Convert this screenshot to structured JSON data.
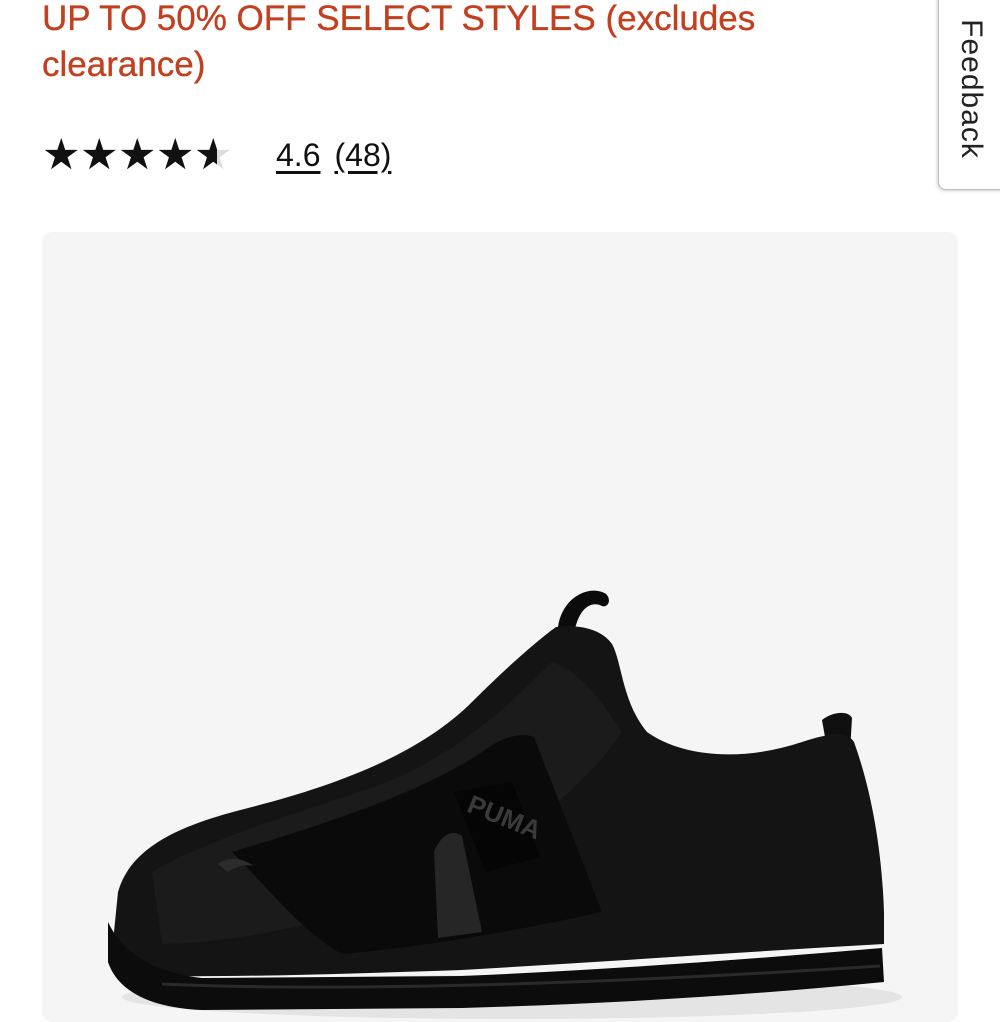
{
  "promo": {
    "text": "UP TO 50% OFF SELECT STYLES (excludes clearance)",
    "color": "#c2401f"
  },
  "rating": {
    "value": "4.6",
    "review_count": "(48)",
    "stars_total": 5,
    "stars_value": 4.6,
    "star_icon": "star-icon"
  },
  "feedback": {
    "label": "Feedback"
  },
  "product": {
    "image_icon": "slip-on-sneaker-image",
    "brand_mark": "PUMA",
    "shoe_color": "#111111",
    "image_background": "#f5f5f5"
  }
}
